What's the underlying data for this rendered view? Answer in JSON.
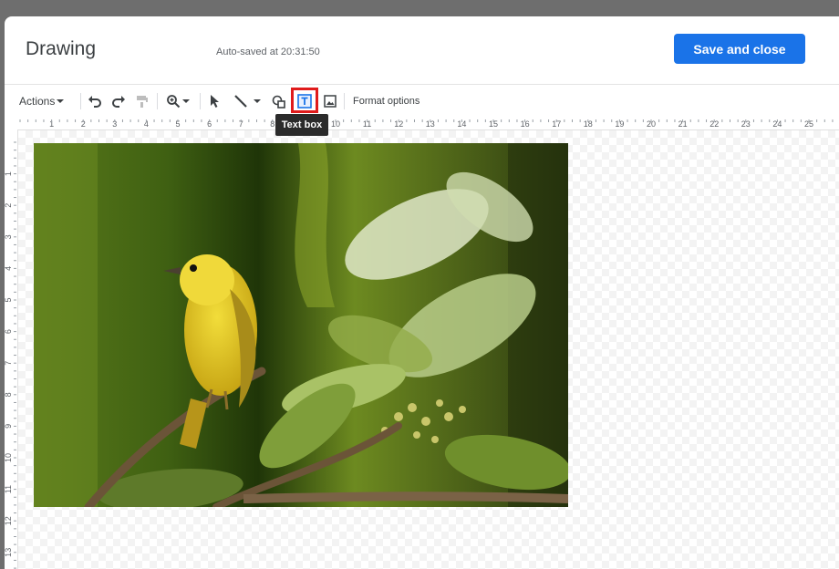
{
  "dialog": {
    "title": "Drawing",
    "autosave": "Auto-saved at 20:31:50",
    "save_button": "Save and close"
  },
  "toolbar": {
    "actions_label": "Actions",
    "format_options_label": "Format options",
    "icons": [
      "undo-icon",
      "redo-icon",
      "paint-format-icon",
      "zoom-icon",
      "select-icon",
      "line-icon",
      "shape-icon",
      "text-box-icon",
      "image-icon"
    ],
    "tooltip": "Text box"
  },
  "ruler": {
    "h_numbers": [
      "1",
      "2",
      "3",
      "4",
      "5",
      "6",
      "7",
      "8",
      "9",
      "10",
      "11",
      "12",
      "13",
      "14",
      "15",
      "16",
      "17",
      "18",
      "19",
      "20",
      "21",
      "22",
      "23",
      "24",
      "25"
    ],
    "v_numbers": [
      "1",
      "2",
      "3",
      "4",
      "5",
      "6",
      "7",
      "8",
      "9",
      "10",
      "11",
      "12",
      "13"
    ]
  },
  "canvas": {
    "image_subject": "yellow warbler perched on branch"
  },
  "colors": {
    "accent": "#1a73e8",
    "highlight": "#e01b1b",
    "tooltip_bg": "#2b2b2b"
  }
}
